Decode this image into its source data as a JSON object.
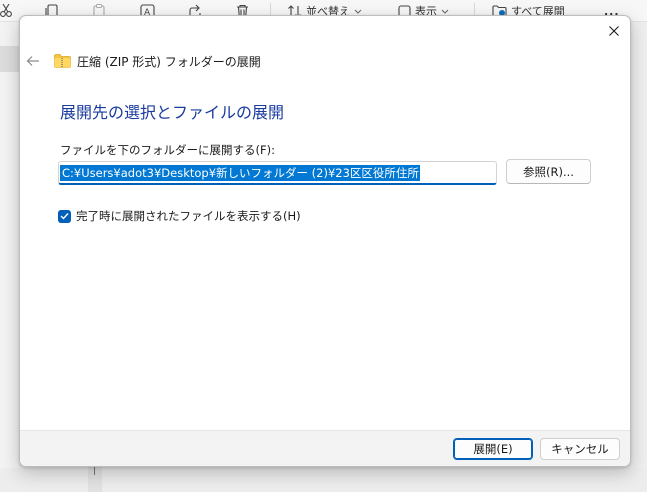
{
  "explorer": {
    "toolbar": {
      "sort_label": "並べ替え",
      "view_label": "表示",
      "extract_all_label": "すべて展開",
      "more_label": "..."
    }
  },
  "dialog": {
    "title": "圧縮 (ZIP 形式) フォルダーの展開",
    "heading": "展開先の選択とファイルの展開",
    "destination_label": "ファイルを下のフォルダーに展開する(F):",
    "destination_value": "C:¥Users¥adot3¥Desktop¥新しいフォルダー (2)¥23区区役所住所",
    "browse_label": "参照(R)...",
    "show_files_label": "完了時に展開されたファイルを表示する(H)",
    "show_files_checked": true,
    "extract_button": "展開(E)",
    "cancel_button": "キャンセル"
  },
  "colors": {
    "accent": "#005fb8",
    "heading": "#1a3b9f",
    "selection": "#0078d4"
  }
}
